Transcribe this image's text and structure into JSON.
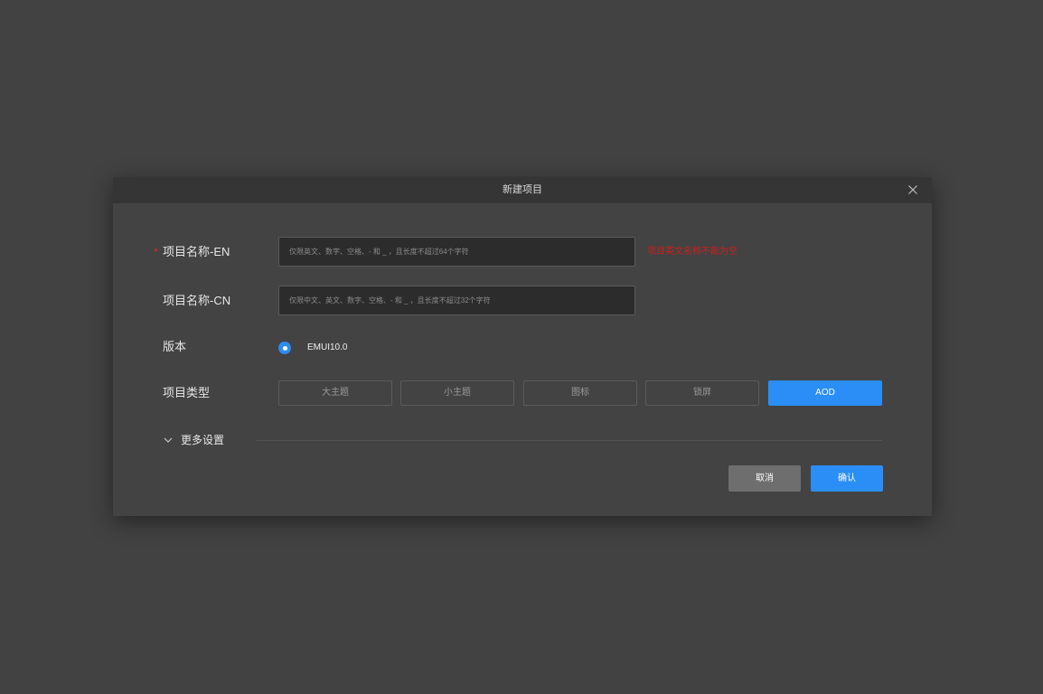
{
  "dialog": {
    "title": "新建项目",
    "close_icon": "close-icon"
  },
  "form": {
    "name_en": {
      "required_mark": "*",
      "label": "项目名称-EN",
      "value": "",
      "placeholder": "仅限英文、数字、空格、- 和 _ ，且长度不超过64个字符",
      "error": "项目英文名称不能为空"
    },
    "name_cn": {
      "label": "项目名称-CN",
      "value": "",
      "placeholder": "仅限中文、英文、数字、空格、- 和 _ ，且长度不超过32个字符"
    },
    "version": {
      "label": "版本",
      "options": [
        "EMUI10.0"
      ],
      "selected": "EMUI10.0"
    },
    "type": {
      "label": "项目类型",
      "options": [
        "大主题",
        "小主题",
        "图标",
        "锁屏",
        "AOD"
      ],
      "selected": "AOD"
    },
    "more_settings": {
      "label": "更多设置",
      "icon": "chevron-down-icon"
    }
  },
  "actions": {
    "cancel_label": "取消",
    "confirm_label": "确认"
  },
  "colors": {
    "accent": "#2a8ef6",
    "error": "#cc1e1e",
    "backdrop": "#424242",
    "dialog_bg": "#434343",
    "titlebar_bg": "#353535"
  }
}
